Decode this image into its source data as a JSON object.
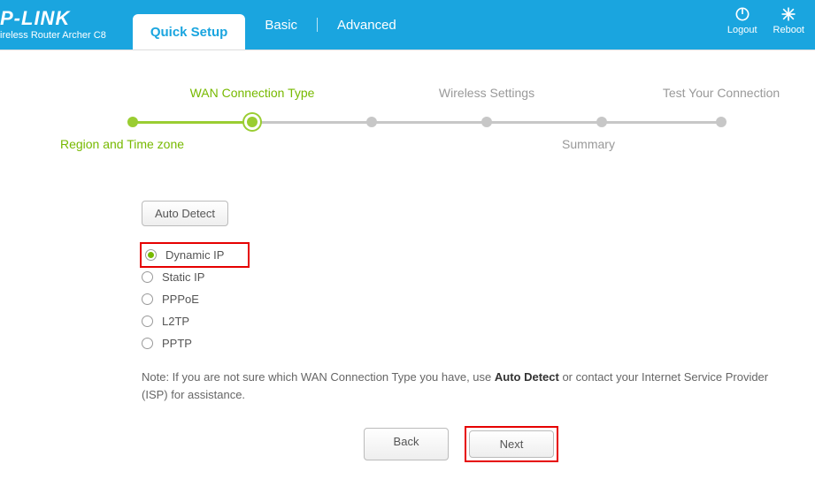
{
  "brand": {
    "logo": "P-LINK",
    "sub": "ireless Router Archer C8"
  },
  "tabs": {
    "quick": "Quick Setup",
    "basic": "Basic",
    "advanced": "Advanced"
  },
  "header_actions": {
    "logout": "Logout",
    "reboot": "Reboot"
  },
  "stepper": {
    "top": {
      "wan": "WAN Connection Type",
      "wireless": "Wireless Settings",
      "test": "Test Your Connection"
    },
    "bottom": {
      "region": "Region and Time zone",
      "summary": "Summary"
    }
  },
  "form": {
    "auto_detect": "Auto Detect",
    "options": {
      "dynamic": "Dynamic IP",
      "static": "Static IP",
      "pppoe": "PPPoE",
      "l2tp": "L2TP",
      "pptp": "PPTP"
    },
    "note_pre": "Note: If you are not sure which WAN Connection Type you have, use ",
    "note_bold": "Auto Detect",
    "note_post": " or contact your Internet Service Provider (ISP) for assistance."
  },
  "nav": {
    "back": "Back",
    "next": "Next"
  }
}
